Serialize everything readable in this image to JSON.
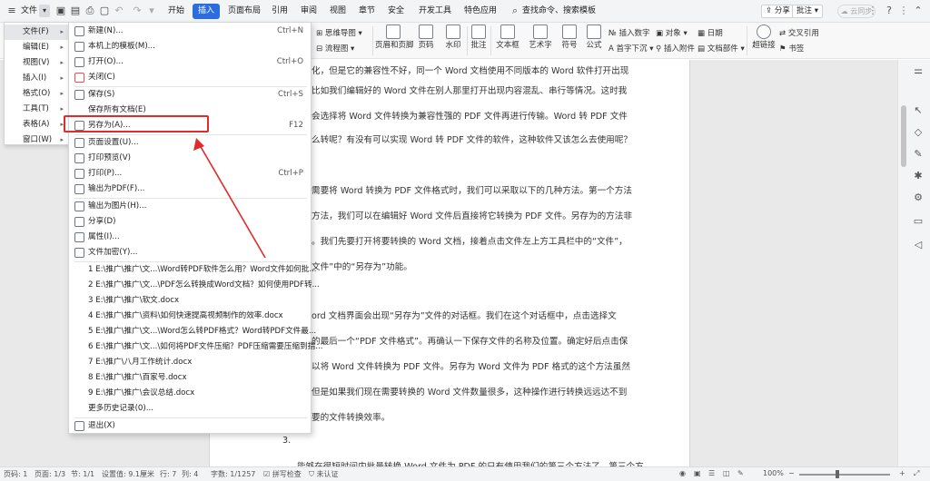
{
  "topbar": {
    "file_label": "文件",
    "menus": [
      "开始",
      "插入",
      "页面布局",
      "引用",
      "审阅",
      "视图",
      "章节",
      "安全",
      "开发工具",
      "特色应用"
    ],
    "active_menu_index": 1,
    "search_text": "查找命令、搜索模板",
    "share_label": "分享",
    "annotate_label": "批注",
    "cloud_label": "云同步",
    "help_label": "?"
  },
  "ribbon": {
    "items": [
      "思维导图",
      "流程图",
      "页眉和页脚",
      "页码",
      "水印",
      "批注",
      "文本框",
      "艺术字",
      "符号",
      "公式",
      "插入数字",
      "首字下沉",
      "对象",
      "插入附件",
      "日期",
      "文档部件",
      "超链接",
      "交叉引用",
      "书签"
    ]
  },
  "left_menu": {
    "items": [
      {
        "label": "文件(F)",
        "active": true
      },
      {
        "label": "编辑(E)"
      },
      {
        "label": "视图(V)"
      },
      {
        "label": "插入(I)"
      },
      {
        "label": "格式(O)"
      },
      {
        "label": "工具(T)"
      },
      {
        "label": "表格(A)"
      },
      {
        "label": "窗口(W)"
      }
    ]
  },
  "submenu": {
    "items": [
      {
        "label": "新建(N)...",
        "shortcut": "Ctrl+N"
      },
      {
        "label": "本机上的模板(M)...",
        "shortcut": ""
      },
      {
        "label": "打开(O)...",
        "shortcut": "Ctrl+O"
      },
      {
        "label": "关闭(C)",
        "shortcut": ""
      },
      {
        "label": "保存(S)",
        "shortcut": "Ctrl+S"
      },
      {
        "label": "保存所有文档(E)",
        "shortcut": ""
      },
      {
        "label": "另存为(A)...",
        "shortcut": "F12"
      },
      {
        "label": "页面设置(U)...",
        "shortcut": ""
      },
      {
        "label": "打印预览(V)",
        "shortcut": ""
      },
      {
        "label": "打印(P)...",
        "shortcut": "Ctrl+P"
      },
      {
        "label": "输出为PDF(F)...",
        "shortcut": ""
      },
      {
        "label": "输出为图片(H)...",
        "shortcut": ""
      },
      {
        "label": "分享(D)",
        "shortcut": ""
      },
      {
        "label": "属性(I)...",
        "shortcut": ""
      },
      {
        "label": "文件加密(Y)...",
        "shortcut": ""
      }
    ],
    "recent": [
      "1 E:\\推广\\推广\\文...\\Word转PDF软件怎么用？Word文件如何批...",
      "2 E:\\推广\\推广\\文...\\PDF怎么转换成Word文档？如何使用PDF转...",
      "3 E:\\推广\\推广\\软文.docx",
      "4 E:\\推广\\推广\\资料\\如何快速提高视频制作的效率.docx",
      "5 E:\\推广\\推广\\文...\\Word怎么转PDF格式？Word转PDF文件最...",
      "6 E:\\推广\\推广\\文...\\如何将PDF文件压缩？PDF压缩需要压缩到指...",
      "7 E:\\推广\\八月工作统计.docx",
      "8 E:\\推广\\推广\\百家号.docx",
      "9 E:\\推广\\推广\\会议总结.docx"
    ],
    "more_history": "更多历史记录(0)...",
    "exit": "退出(X)"
  },
  "document": {
    "lines": [
      "化，但是它的兼容性不好，同一个 Word 文档使用不同版本的 Word 软件打开出现",
      "比如我们编辑好的 Word 文件在别人那里打开出现内容混乱、串行等情况。这时我",
      "会选择将 Word 文件转换为兼容性强的 PDF 文件再进行传输。Word 转 PDF 文件",
      "么转呢？有没有可以实现 Word 转 PDF 文件的软件，这种软件又该怎么去使用呢？",
      "需要将 Word 转换为 PDF 文件格式时，我们可以采取以下的几种方法。第一个方法",
      "方法，我们可以在编辑好 Word 文件后直接将它转换为 PDF 文件。另存为的方法非",
      "。我们先要打开将要转换的 Word 文档，接着点击文件左上方工具栏中的“文件”，",
      "文件”中的“另存为”功能。",
      "ord 文档界面会出现“另存为”文件的对话框。我们在这个对话框中，点击选择文",
      "的最后一个“PDF 文件格式”。再确认一下保存文件的名称及位置。确定好后点击保",
      "以将 Word 文件转换为 PDF 文件。另存为 Word 文件为 PDF 格式的这个方法虽然",
      "但是如果我们现在需要转换的 Word 文件数量很多，这种操作进行转换远远达不到",
      "要的文件转换效率。",
      "3.",
      "能够在很短时间内批量转换 Word 文件为 PDF 的只有使用我们的第三个方法了，第三个方"
    ]
  },
  "statusbar": {
    "page": "页码: 1",
    "pages": "页面: 1/3",
    "section": "节: 1/1",
    "position": "设置值: 9.1厘米",
    "row": "行: 7",
    "col": "列: 4",
    "words": "字数: 1/1257",
    "spell": "拼写检查",
    "auth": "未认证",
    "zoom": "100%"
  }
}
